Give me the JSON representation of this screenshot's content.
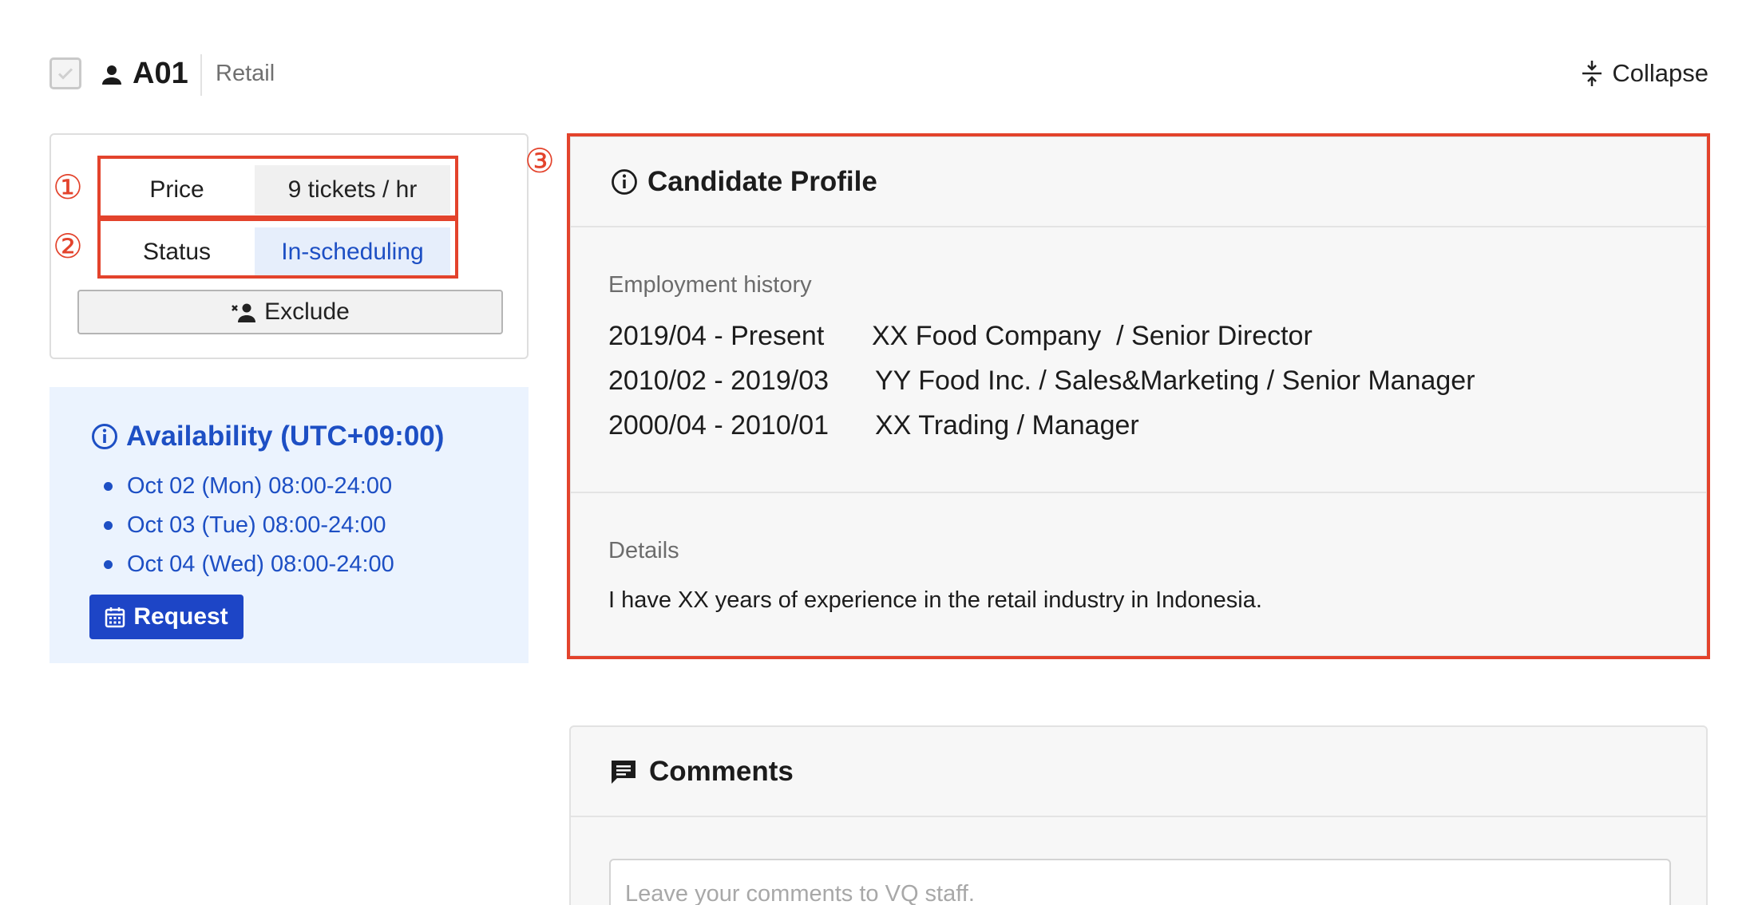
{
  "header": {
    "candidate_id": "A01",
    "industry": "Retail",
    "collapse_label": "Collapse"
  },
  "summary": {
    "price_label": "Price",
    "price_value": "9 tickets / hr",
    "status_label": "Status",
    "status_value": "In-scheduling",
    "exclude_label": "Exclude"
  },
  "annotations": {
    "one": "①",
    "two": "②",
    "three": "③"
  },
  "availability": {
    "title": "Availability (UTC+09:00)",
    "slots": [
      "Oct 02 (Mon) 08:00-24:00",
      "Oct 03 (Tue) 08:00-24:00",
      "Oct 04 (Wed) 08:00-24:00"
    ],
    "request_label": "Request"
  },
  "profile": {
    "title": "Candidate Profile",
    "employment_label": "Employment history",
    "employment": [
      {
        "period": "2019/04 - Present",
        "desc": "XX Food Company  / Senior Director"
      },
      {
        "period": "2010/02 - 2019/03",
        "desc": "YY Food Inc. / Sales&Marketing / Senior Manager"
      },
      {
        "period": "2000/04 - 2010/01",
        "desc": "XX Trading / Manager"
      }
    ],
    "details_label": "Details",
    "details_text": "I have XX years of experience in the retail industry in Indonesia."
  },
  "comments": {
    "title": "Comments",
    "placeholder": "Leave your comments to VQ staff."
  },
  "colors": {
    "accent_blue": "#1d45c6",
    "highlight_red": "#e3432c",
    "availability_bg": "#ebf3fe"
  }
}
